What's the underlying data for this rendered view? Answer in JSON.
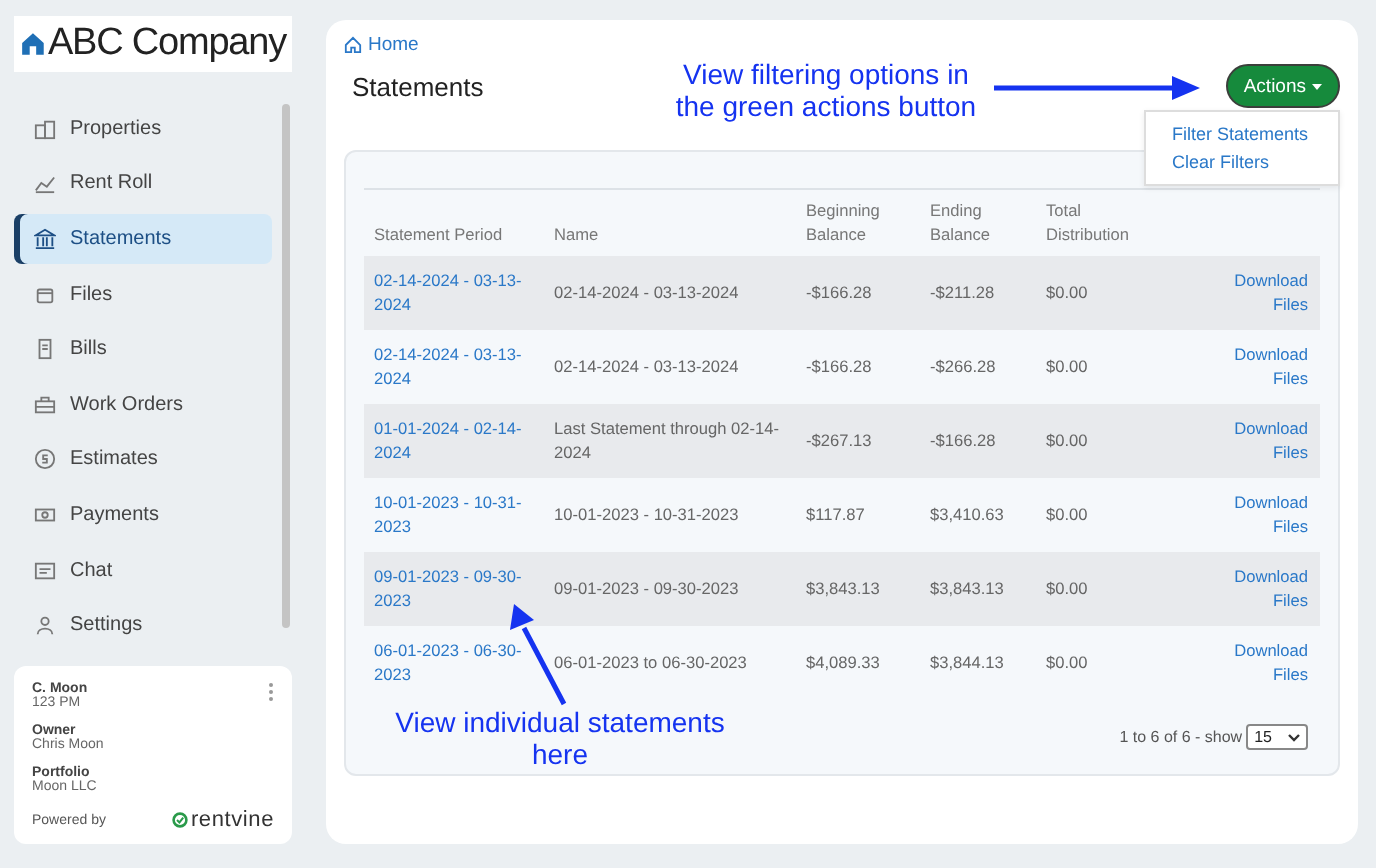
{
  "sidebar": {
    "logo_text": "ABC Company",
    "items": [
      {
        "label": "Properties",
        "selected": false
      },
      {
        "label": "Rent Roll",
        "selected": false
      },
      {
        "label": "Statements",
        "selected": true
      },
      {
        "label": "Files",
        "selected": false
      },
      {
        "label": "Bills",
        "selected": false
      },
      {
        "label": "Work Orders",
        "selected": false
      },
      {
        "label": "Estimates",
        "selected": false
      },
      {
        "label": "Payments",
        "selected": false
      },
      {
        "label": "Chat",
        "selected": false
      },
      {
        "label": "Settings",
        "selected": false
      }
    ],
    "user_card": {
      "name": "C. Moon",
      "unit": "123 PM",
      "fields": [
        {
          "label": "Owner",
          "value": "Chris Moon"
        },
        {
          "label": "Portfolio",
          "value": "Moon LLC"
        }
      ],
      "powered_by": "Powered by",
      "brand": "rentvine"
    }
  },
  "breadcrumb": "Home",
  "title": "Statements",
  "actions": {
    "label": "Actions",
    "expanded": true,
    "menu": [
      "Filter Statements",
      "Clear Filters"
    ]
  },
  "table": {
    "columns": [
      "Statement Period",
      "Name",
      "Beginning Balance",
      "Ending Balance",
      "Total Distribution"
    ],
    "rows": [
      {
        "period": "02-14-2024 - 03-13-2024",
        "name": "02-14-2024 - 03-13-2024",
        "beginning": "-$166.28",
        "ending": "-$211.28",
        "total": "$0.00",
        "action": "Download Files"
      },
      {
        "period": "02-14-2024 - 03-13-2024",
        "name": "02-14-2024 - 03-13-2024",
        "beginning": "-$166.28",
        "ending": "-$266.28",
        "total": "$0.00",
        "action": "Download Files"
      },
      {
        "period": "01-01-2024 - 02-14-2024",
        "name": "Last Statement through 02-14-2024",
        "beginning": "-$267.13",
        "ending": "-$166.28",
        "total": "$0.00",
        "action": "Download Files"
      },
      {
        "period": "10-01-2023 - 10-31-2023",
        "name": "10-01-2023 - 10-31-2023",
        "beginning": "$117.87",
        "ending": "$3,410.63",
        "total": "$0.00",
        "action": "Download Files"
      },
      {
        "period": "09-01-2023 - 09-30-2023",
        "name": "09-01-2023 - 09-30-2023",
        "beginning": "$3,843.13",
        "ending": "$3,843.13",
        "total": "$0.00",
        "action": "Download Files"
      },
      {
        "period": "06-01-2023 - 06-30-2023",
        "name": "06-01-2023 to 06-30-2023",
        "beginning": "$4,089.33",
        "ending": "$3,844.13",
        "total": "$0.00",
        "action": "Download Files"
      }
    ],
    "pager": "1 to 6 of 6 - show",
    "page_size": "15"
  },
  "annotations": [
    {
      "text": "View filtering options in the green actions button"
    },
    {
      "text": "View individual statements here"
    }
  ]
}
